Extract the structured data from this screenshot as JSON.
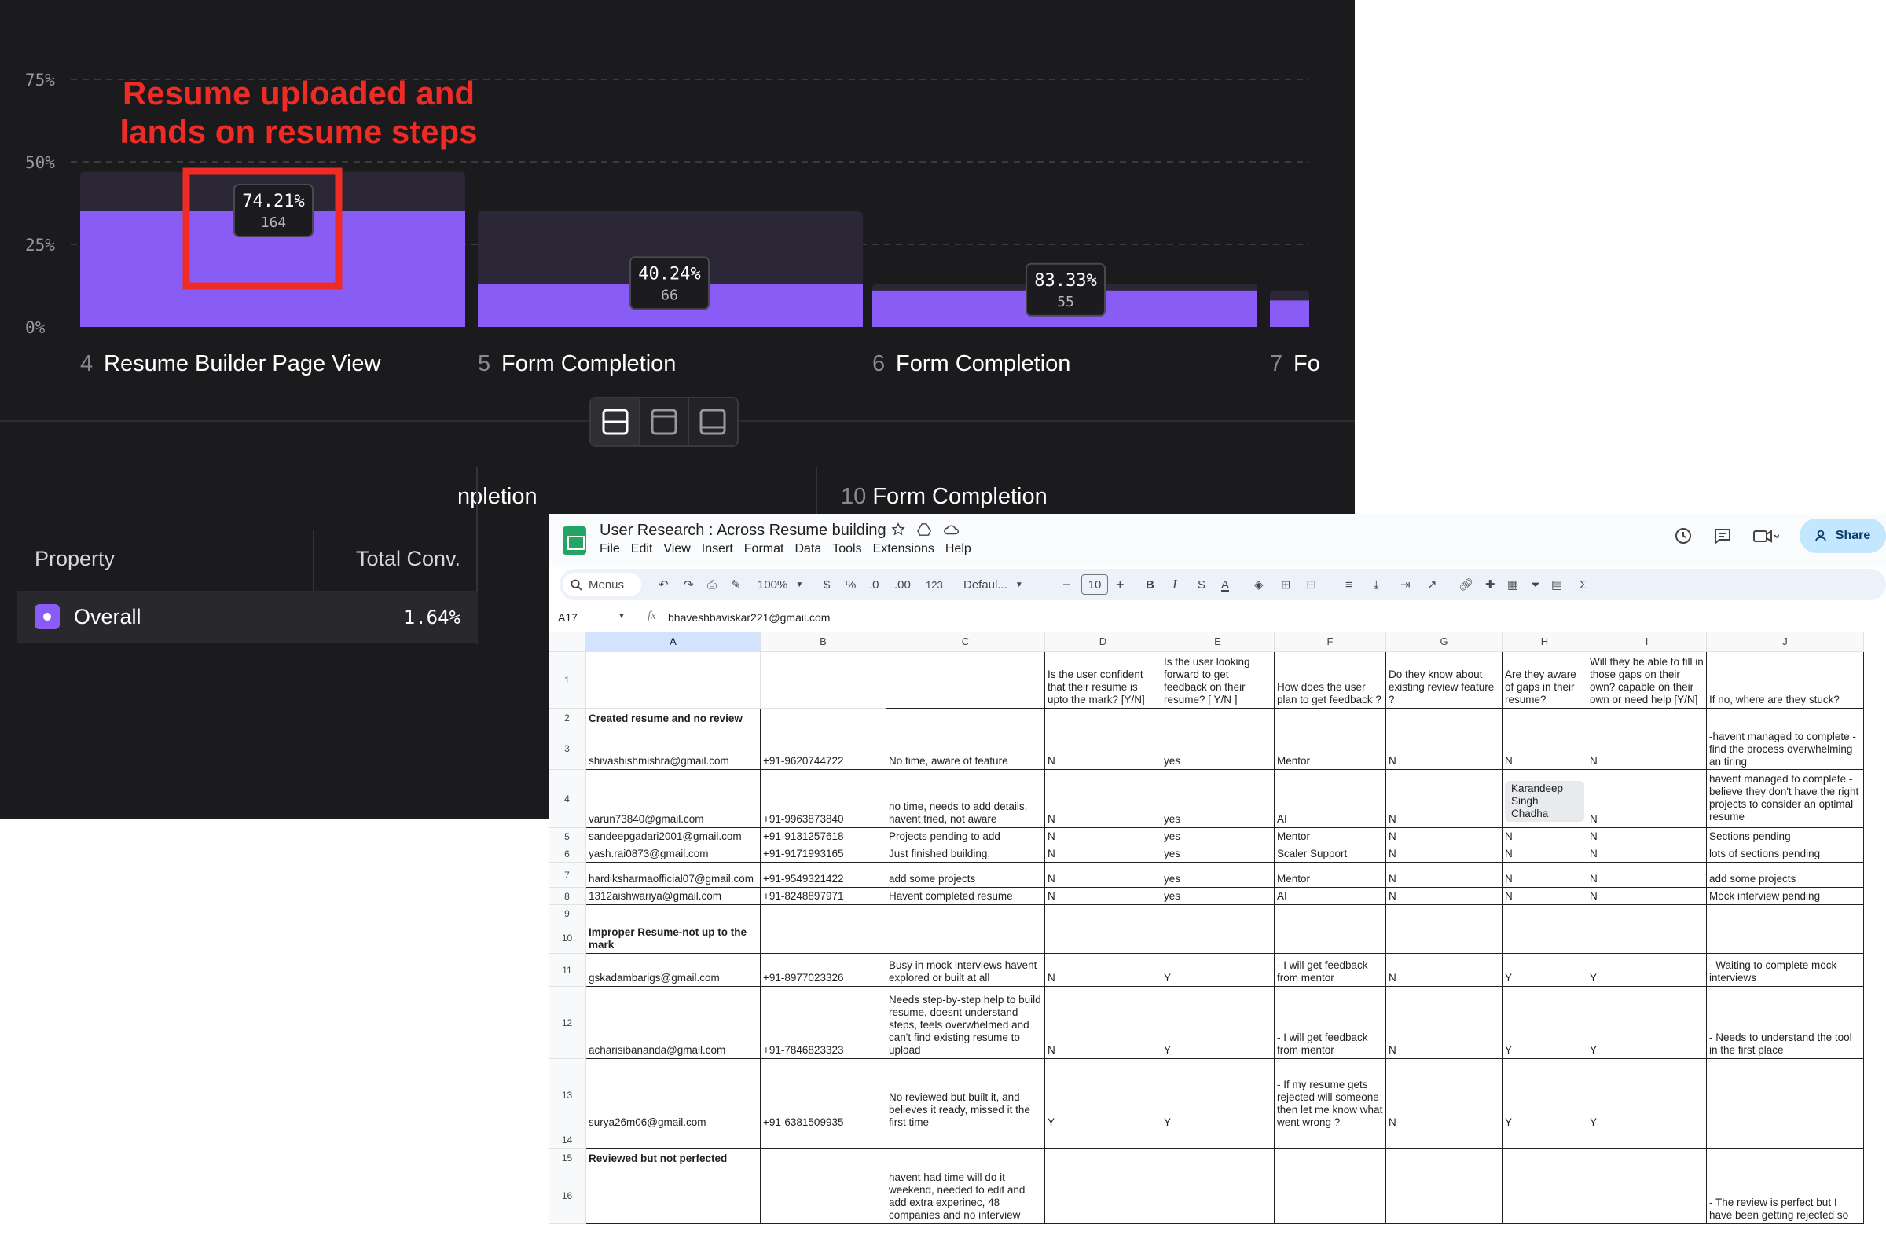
{
  "funnel": {
    "annotation_lines": [
      "Resume uploaded and",
      "lands on resume steps"
    ],
    "chart_data": {
      "type": "bar",
      "y_ticks": [
        "0%",
        "25%",
        "50%",
        "75%"
      ],
      "ylim": [
        0,
        90
      ],
      "steps": [
        {
          "number": "4",
          "name": "Resume Builder Page View",
          "value": 35,
          "previous": 47,
          "tooltip_pct": "74.21%",
          "tooltip_count": "164"
        },
        {
          "number": "5",
          "name": "Form Completion",
          "value": 13,
          "previous": 35,
          "tooltip_pct": "40.24%",
          "tooltip_count": "66"
        },
        {
          "number": "6",
          "name": "Form Completion",
          "value": 11,
          "previous": 13,
          "tooltip_pct": "83.33%",
          "tooltip_count": "55"
        },
        {
          "number": "7",
          "name": "Fo",
          "value": 8,
          "previous": 11,
          "tooltip_pct": "",
          "tooltip_count": ""
        }
      ]
    },
    "lower_steps": [
      {
        "number": "",
        "name": "npletion"
      },
      {
        "number": "10",
        "name": "Form Completion"
      }
    ],
    "property_table": {
      "headers": [
        "Property",
        "Total Conv."
      ],
      "row": {
        "name": "Overall",
        "value": "1.64%",
        "color": "#8a5cf6"
      }
    },
    "colors": {
      "bar": "#8a5cf6",
      "bar_prev": "#2b2737",
      "annotation": "#ee2c25"
    }
  },
  "sheet": {
    "title": "User Research : Across Resume building",
    "menu": [
      "File",
      "Edit",
      "View",
      "Insert",
      "Format",
      "Data",
      "Tools",
      "Extensions",
      "Help"
    ],
    "share_label": "Share",
    "toolbar": {
      "search": "Menus",
      "zoom": "100%",
      "currency": "$",
      "percent": "%",
      "dec_minus": ".0",
      "dec_plus": ".00",
      "number_fmt": "123",
      "font": "Defaul...",
      "font_size": "10",
      "minus": "−",
      "plus": "+",
      "bold": "B",
      "italic": "I",
      "strike": "S",
      "text_color": "A",
      "sum": "Σ"
    },
    "cell_ref": "A17",
    "formula_value": "bhaveshbaviskar221@gmail.com",
    "columns": [
      "A",
      "B",
      "C",
      "D",
      "E",
      "F",
      "G",
      "H",
      "I",
      "J"
    ],
    "header_row": [
      "",
      "",
      "",
      "Is the user confident that their resume is upto the mark? [Y/N]",
      "Is the user looking forward to get feedback on their resume? [ Y/N ]",
      "How does the user plan to get feedback ?",
      "Do they know about existing review feature ?",
      "Are they aware of gaps in their resume?",
      "Will they be able to fill in those gaps on their own? capable on their own or need help [Y/N]",
      "If no, where are they stuck?"
    ],
    "rows": [
      {
        "n": "2",
        "cells": [
          "Created resume and no review",
          "",
          "",
          "",
          "",
          "",
          "",
          "",
          "",
          ""
        ],
        "section": true
      },
      {
        "n": "3",
        "cells": [
          "shivashishmishra@gmail.com",
          "+91-9620744722",
          "No time, aware of feature",
          "N",
          "yes",
          "Mentor",
          "N",
          "N",
          "N",
          "-havent managed to complete -find the process overwhelming an tiring"
        ]
      },
      {
        "n": "4",
        "cells": [
          "varun73840@gmail.com",
          "+91-9963873840",
          "no time, needs to add details, havent tried, not aware",
          "N",
          "yes",
          "AI",
          "N",
          "Karandeep Singh Chadha",
          "N",
          " havent managed to complete -believe they don't have the right projects to consider an optimal resume"
        ]
      },
      {
        "n": "5",
        "cells": [
          "sandeepgadari2001@gmail.com",
          "+91-9131257618",
          "Projects pending to add",
          "N",
          "yes",
          "Mentor",
          "N",
          "N",
          "N",
          "Sections pending"
        ]
      },
      {
        "n": "6",
        "cells": [
          "yash.rai0873@gmail.com",
          "+91-9171993165",
          "Just finished building,",
          "N",
          "yes",
          "Scaler Support",
          "N",
          "N",
          "N",
          "lots of sections pending"
        ]
      },
      {
        "n": "7",
        "cells": [
          "hardiksharmaofficial07@gmail.com",
          "+91-9549321422",
          "add some projects",
          "N",
          "yes",
          "Mentor",
          "N",
          "N",
          "N",
          "add some projects"
        ]
      },
      {
        "n": "8",
        "cells": [
          "1312aishwariya@gmail.com",
          "+91-8248897971",
          "Havent completed resume",
          "N",
          "yes",
          "AI",
          "N",
          "N",
          "N",
          "Mock interview pending"
        ]
      },
      {
        "n": "9",
        "cells": [
          "",
          "",
          "",
          "",
          "",
          "",
          "",
          "",
          "",
          ""
        ]
      },
      {
        "n": "10",
        "cells": [
          "Improper Resume-not up to the mark",
          "",
          "",
          "",
          "",
          "",
          "",
          "",
          "",
          ""
        ],
        "section": true
      },
      {
        "n": "11",
        "cells": [
          "gskadambarigs@gmail.com",
          "+91-8977023326",
          "Busy in mock interviews havent explored or built at all",
          "N",
          "Y",
          "- I will get feedback from mentor",
          "N",
          "Y",
          "Y",
          "- Waiting to complete mock interviews"
        ]
      },
      {
        "n": "12",
        "cells": [
          "acharisibananda@gmail.com",
          "+91-7846823323",
          "Needs step-by-step help to build resume, doesnt understand steps, feels overwhelmed and can't find existing resume to upload",
          "N",
          "Y",
          "- I will get feedback from mentor",
          "N",
          "Y",
          "Y",
          "- Needs to understand the tool in the first place"
        ]
      },
      {
        "n": "13",
        "cells": [
          "surya26m06@gmail.com",
          "+91-6381509935",
          "No reviewed but built it, and believes it ready, missed it the first time",
          "Y",
          "Y",
          "- If my resume gets rejected will someone then let me know what went wrong ?",
          "N",
          "Y",
          "Y",
          ""
        ]
      },
      {
        "n": "14",
        "cells": [
          "",
          "",
          "",
          "",
          "",
          "",
          "",
          "",
          "",
          ""
        ]
      },
      {
        "n": "15",
        "cells": [
          "Reviewed but not perfected",
          "",
          "",
          "",
          "",
          "",
          "",
          "",
          "",
          ""
        ],
        "section": true
      },
      {
        "n": "16",
        "cells": [
          "",
          "",
          "havent had time will do it weekend, needed to edit and add extra experinec, 48 companies and no interview",
          "",
          "",
          "",
          "",
          "",
          "",
          "- The review is perfect but I have been getting rejected so"
        ]
      }
    ]
  }
}
